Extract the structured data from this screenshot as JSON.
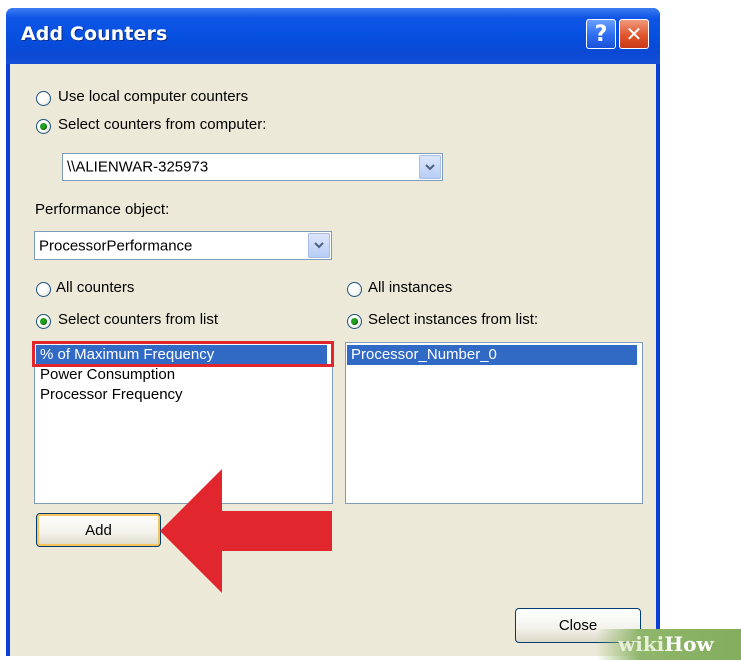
{
  "window": {
    "title": "Add Counters",
    "help_glyph": "?",
    "close_glyph": "✕"
  },
  "computer_source": {
    "local_option": "Use local computer counters",
    "remote_option": "Select counters from computer:",
    "selected": "remote",
    "computer_value": "\\\\ALIENWAR-325973"
  },
  "performance_object": {
    "label": "Performance object:",
    "value": "ProcessorPerformance"
  },
  "counters": {
    "all_option": "All counters",
    "list_option": "Select counters from list",
    "selected": "list",
    "items": [
      "% of Maximum Frequency",
      "Power Consumption",
      "Processor Frequency"
    ],
    "selected_item": "% of Maximum Frequency"
  },
  "instances": {
    "all_option": "All instances",
    "list_option": "Select instances from list:",
    "selected": "list",
    "items": [
      "Processor_Number_0"
    ],
    "selected_item": "Processor_Number_0"
  },
  "buttons": {
    "add": "Add",
    "close": "Close"
  },
  "annotations": {
    "highlight_color": "#e2262e",
    "arrow_color": "#e2262e"
  },
  "watermark": {
    "part1": "wiki",
    "part2": "How"
  },
  "colors": {
    "titlebar": "#0650e0",
    "dialog_face": "#ece9d8",
    "selection": "#316ac5"
  }
}
